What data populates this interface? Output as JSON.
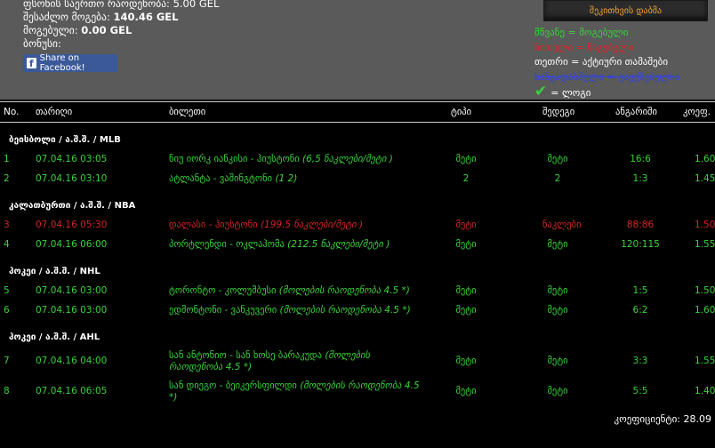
{
  "info": {
    "stake_label": "ფსონის საერთო რაოდენობა:",
    "stake_value": "5.00 GEL",
    "possible_label": "შესაძლო მოგება:",
    "possible_value": "140.46 GEL",
    "won_label": "მოგებული:",
    "won_value": "0.00 GEL",
    "bonus_label": "ბონუსი:"
  },
  "facebook_label": "Share on Facebook!",
  "compare_button": "შეკითხვის დაბმა",
  "legend": {
    "green": "მწვანე = მოგებული",
    "red": "წითელი = წაგებული",
    "white": "თეთრი = აქტიური თამაშები",
    "blue": "ხაზგადასმული = გაუქმებულია",
    "check": "= ლოგი"
  },
  "columns": {
    "no": "No.",
    "date": "თარიღი",
    "ticket": "ბილეთი",
    "type": "ტიპი",
    "result": "შედეგი",
    "score": "ანგარიში",
    "coef": "კოეფ."
  },
  "groups": [
    {
      "title": "ბეისბოლი / ა.შ.შ. / MLB"
    },
    {
      "title": "კალათბურთი / ა.შ.შ. / NBA"
    },
    {
      "title": "ჰოკეი / ა.შ.შ. / NHL"
    },
    {
      "title": "ჰოკეი / ა.შ.შ. / AHL"
    }
  ],
  "rows": [
    {
      "no": "1",
      "date": "07.04.16 03:05",
      "match": "ნიუ იორკ იანკისი - ჰიუსტონი ",
      "note": "(6,5 ნაკლები/მეტი )",
      "type": "მეტი",
      "result": "მეტი",
      "score": "16:6",
      "coef": "1.60"
    },
    {
      "no": "2",
      "date": "07.04.16 03:10",
      "match": "ატლანტა - ვაშინგტონი ",
      "note": "(1 2)",
      "type": "2",
      "result": "2",
      "score": "1:3",
      "coef": "1.45"
    },
    {
      "no": "3",
      "date": "07.04.16 05:30",
      "match": "დალასი - ჰიუსტონი ",
      "note": "(199.5 ნაკლები/მეტი )",
      "type": "მეტი",
      "result": "ნაკლები",
      "score": "88:86",
      "coef": "1.50"
    },
    {
      "no": "4",
      "date": "07.04.16 06:00",
      "match": "პორტლენდი - ოკლაჰომა ",
      "note": "(212.5 ნაკლები/მეტი )",
      "type": "მეტი",
      "result": "მეტი",
      "score": "120:115",
      "coef": "1.55"
    },
    {
      "no": "5",
      "date": "07.04.16 03:00",
      "match": "ტორონტო - კოლუმბუსი ",
      "note": "(მოლების რაოდენობა 4.5 *)",
      "type": "მეტი",
      "result": "მეტი",
      "score": "1:5",
      "coef": "1.50"
    },
    {
      "no": "6",
      "date": "07.04.16 03:00",
      "match": "ედმონტონი - ვანკუვერი ",
      "note": "(მოლების რაოდენობა 4.5 *)",
      "type": "მეტი",
      "result": "მეტი",
      "score": "6:2",
      "coef": "1.60"
    },
    {
      "no": "7",
      "date": "07.04.16 04:00",
      "match": "სან ანტონიო - სან ხოსე ბარაკუდა ",
      "note": "(მოლების რაოდენობა 4.5 *)",
      "type": "მეტი",
      "result": "მეტი",
      "score": "3:3",
      "coef": "1.55"
    },
    {
      "no": "8",
      "date": "07.04.16 06:05",
      "match": "სან დიეგო - ბეიკერსფილდი ",
      "note": "(მოლების რაოდენობა 4.5 *)",
      "type": "მეტი",
      "result": "მეტი",
      "score": "5:5",
      "coef": "1.40"
    }
  ],
  "total": "კოეფიციენტი: 28.09",
  "colors": {
    "green": "#39d23a",
    "red": "#d42525",
    "panel": "#5a5a5a"
  }
}
